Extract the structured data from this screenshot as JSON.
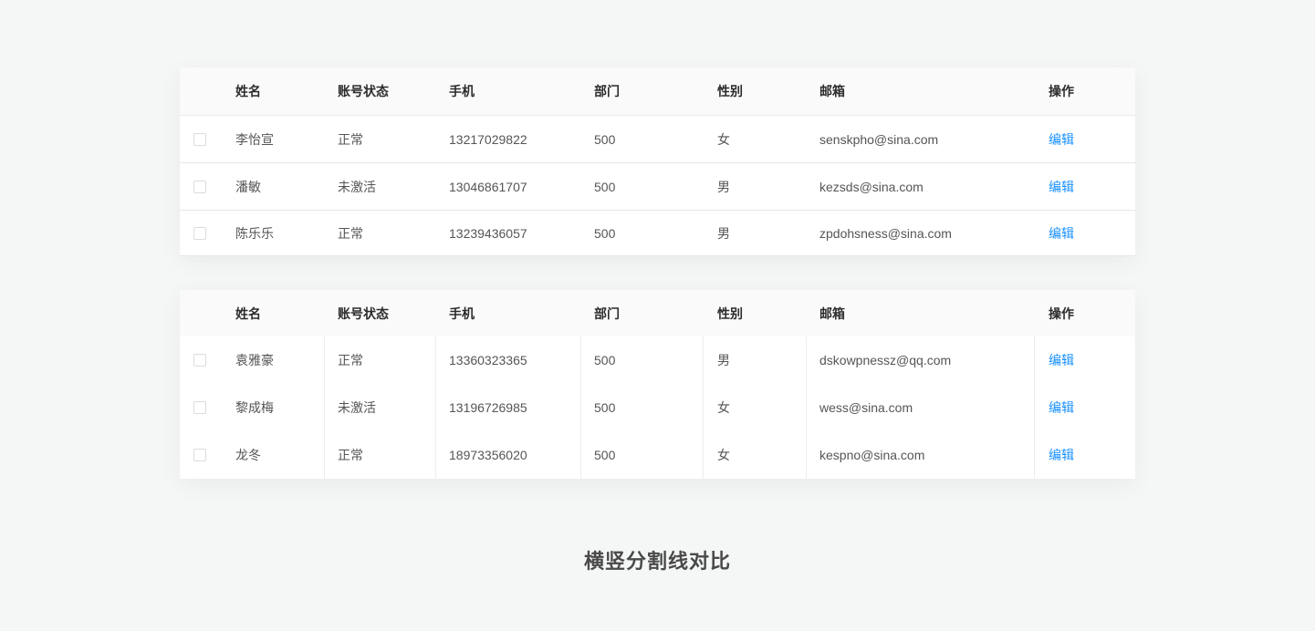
{
  "columns": [
    "姓名",
    "账号状态",
    "手机",
    "部门",
    "性别",
    "邮箱",
    "操作"
  ],
  "table1": {
    "rows": [
      {
        "name": "李怡宣",
        "status": "正常",
        "phone": "13217029822",
        "dept": "500",
        "gender": "女",
        "email": "senskpho@sina.com",
        "action": "编辑"
      },
      {
        "name": "潘敏",
        "status": "未激活",
        "phone": "13046861707",
        "dept": "500",
        "gender": "男",
        "email": "kezsds@sina.com",
        "action": "编辑"
      },
      {
        "name": "陈乐乐",
        "status": "正常",
        "phone": "13239436057",
        "dept": "500",
        "gender": "男",
        "email": "zpdohsness@sina.com",
        "action": "编辑"
      }
    ]
  },
  "table2": {
    "rows": [
      {
        "name": "袁雅豪",
        "status": "正常",
        "phone": "13360323365",
        "dept": "500",
        "gender": "男",
        "email": "dskowpnessz@qq.com",
        "action": "编辑"
      },
      {
        "name": "黎成梅",
        "status": "未激活",
        "phone": "13196726985",
        "dept": "500",
        "gender": "女",
        "email": "wess@sina.com",
        "action": "编辑"
      },
      {
        "name": "龙冬",
        "status": "正常",
        "phone": "18973356020",
        "dept": "500",
        "gender": "女",
        "email": "kespno@sina.com",
        "action": "编辑"
      }
    ]
  },
  "caption": "横竖分割线对比",
  "colors": {
    "accent": "#1890ff",
    "background": "#f5f6f6",
    "header": "#fafafa"
  }
}
